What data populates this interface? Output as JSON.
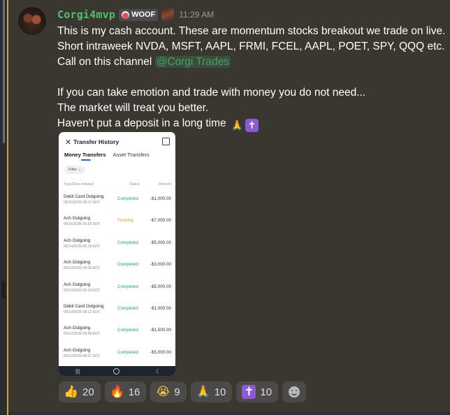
{
  "message": {
    "username": "Corgi4mvp",
    "role_tag": "WOOF",
    "timestamp": "11:29 AM",
    "lines": [
      "This is my cash account.  These are momentum stocks breakout we trade on live.",
      "Short intraweek NVDA, MSFT, AAPL, FRMI, FCEL, AAPL, POET, SPY, QQQ etc.",
      "Call on this channel"
    ],
    "mention": "@Corgi Trades",
    "lines2": [
      "If you can take emotion and trade with money you do not need...",
      "The market will treat you better.",
      "Haven't put a deposit in a long time"
    ],
    "emoji_pray": "🙏",
    "emoji_cross": "✝"
  },
  "phone": {
    "close": "✕",
    "title": "Transfer History",
    "tabs": [
      "Money Transfers",
      "Asset Transfers"
    ],
    "filter": "Filter ⌄",
    "headers": {
      "type_date": "Type/Date Initiated",
      "status": "Status",
      "amount": "Amount"
    },
    "rows": [
      {
        "type": "Debit Card Outgoing",
        "date": "05/15/2026 08:17 EDT",
        "status": "Completed",
        "amount": "-$1,000.00"
      },
      {
        "type": "Ach Outgoing",
        "date": "05/15/2026 06:03 EDT",
        "status": "Pending",
        "amount": "-$7,000.00"
      },
      {
        "type": "Ach Outgoing",
        "date": "05/14/2026 06:18 EDT",
        "status": "Completed",
        "amount": "-$5,000.00"
      },
      {
        "type": "Ach Outgoing",
        "date": "05/13/2026 09:28 EDT",
        "status": "Completed",
        "amount": "-$3,000.00"
      },
      {
        "type": "Ach Outgoing",
        "date": "05/13/2026 06:14 EDT",
        "status": "Completed",
        "amount": "-$5,000.00"
      },
      {
        "type": "Debit Card Outgoing",
        "date": "05/13/2026 08:12 EDT",
        "status": "Completed",
        "amount": "-$1,000.00"
      },
      {
        "type": "Ach Outgoing",
        "date": "05/12/2026 09:58 EDT",
        "status": "Completed",
        "amount": "-$1,500.00"
      },
      {
        "type": "Ach Outgoing",
        "date": "05/12/2026 08:07 EDT",
        "status": "Completed",
        "amount": "-$5,000.00"
      }
    ],
    "nav": [
      "|||",
      "〈"
    ]
  },
  "reactions": [
    {
      "emoji": "👍",
      "count": "20",
      "icon": "thumbs-up-icon"
    },
    {
      "emoji": "🔥",
      "count": "16",
      "icon": "fire-icon"
    },
    {
      "emoji": "😭",
      "count": "9",
      "icon": "crying-face-icon"
    },
    {
      "emoji": "🙏",
      "count": "10",
      "icon": "folded-hands-icon"
    },
    {
      "emoji": "✝",
      "count": "10",
      "icon": "latin-cross-icon"
    }
  ],
  "colors": {
    "username": "#4ec16a",
    "mention": "#3ba55c",
    "completed": "#1aa77c",
    "pending": "#f0a030",
    "highlight_bar": "#d9a233"
  }
}
